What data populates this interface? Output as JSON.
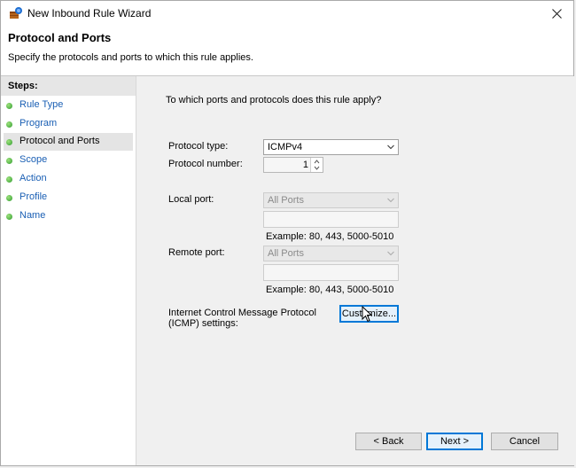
{
  "window": {
    "title": "New Inbound Rule Wizard",
    "icon": "firewall-rule-icon"
  },
  "header": {
    "title": "Protocol and Ports",
    "subtitle": "Specify the protocols and ports to which this rule applies."
  },
  "sidebar": {
    "label": "Steps:",
    "items": [
      {
        "label": "Rule Type",
        "active": false
      },
      {
        "label": "Program",
        "active": false
      },
      {
        "label": "Protocol and Ports",
        "active": true
      },
      {
        "label": "Scope",
        "active": false
      },
      {
        "label": "Action",
        "active": false
      },
      {
        "label": "Profile",
        "active": false
      },
      {
        "label": "Name",
        "active": false
      }
    ]
  },
  "main": {
    "question": "To which ports and protocols does this rule apply?",
    "protocol_type": {
      "label": "Protocol type:",
      "value": "ICMPv4"
    },
    "protocol_number": {
      "label": "Protocol number:",
      "value": "1"
    },
    "local_port": {
      "label": "Local port:",
      "value": "All Ports",
      "example": "Example: 80, 443, 5000-5010"
    },
    "remote_port": {
      "label": "Remote port:",
      "value": "All Ports",
      "example": "Example: 80, 443, 5000-5010"
    },
    "icmp": {
      "label_line1": "Internet Control Message Protocol",
      "label_line2": "(ICMP) settings:",
      "button": "Customize..."
    }
  },
  "footer": {
    "back": "< Back",
    "next": "Next >",
    "cancel": "Cancel"
  },
  "colors": {
    "link": "#1a5fb4",
    "step_dot": "#2f9b2f",
    "default_button_border": "#0078d7"
  }
}
